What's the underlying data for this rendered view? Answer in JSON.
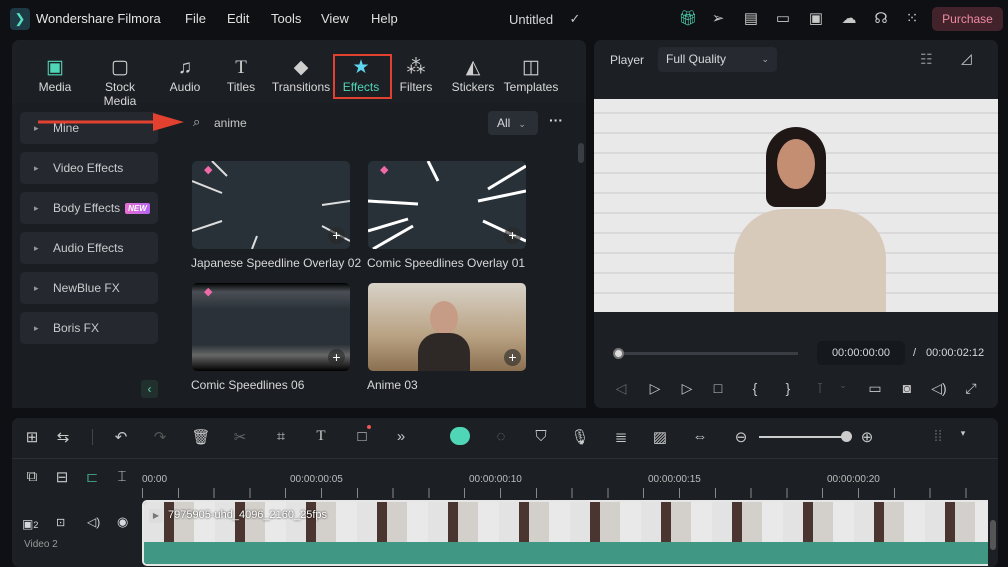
{
  "app": {
    "name": "Wondershare Filmora",
    "project_title": "Untitled",
    "purchase_label": "Purchase"
  },
  "menu": [
    "File",
    "Edit",
    "Tools",
    "View",
    "Help"
  ],
  "tabs": [
    {
      "label": "Media",
      "icon": "media-icon"
    },
    {
      "label": "Stock Media",
      "icon": "stock-media-icon"
    },
    {
      "label": "Audio",
      "icon": "music-note-icon"
    },
    {
      "label": "Titles",
      "icon": "title-t-icon"
    },
    {
      "label": "Transitions",
      "icon": "transitions-icon"
    },
    {
      "label": "Effects",
      "icon": "effects-star-icon",
      "active": true
    },
    {
      "label": "Filters",
      "icon": "filters-icon"
    },
    {
      "label": "Stickers",
      "icon": "stickers-icon"
    },
    {
      "label": "Templates",
      "icon": "templates-icon"
    }
  ],
  "sidebar": {
    "items": [
      {
        "label": "Mine"
      },
      {
        "label": "Video Effects"
      },
      {
        "label": "Body Effects",
        "badge": "NEW"
      },
      {
        "label": "Audio Effects"
      },
      {
        "label": "NewBlue FX"
      },
      {
        "label": "Boris FX"
      }
    ]
  },
  "search": {
    "value": "anime",
    "filter": "All"
  },
  "effects": [
    {
      "label": "Japanese Speedline Overlay 02",
      "premium": true
    },
    {
      "label": "Comic Speedlines Overlay 01",
      "premium": true
    },
    {
      "label": "Comic Speedlines 06",
      "premium": true
    },
    {
      "label": "Anime 03",
      "premium": false
    }
  ],
  "player": {
    "label": "Player",
    "quality": "Full Quality",
    "current_time": "00:00:00:00",
    "separator": "/",
    "total_time": "00:00:02:12",
    "progress": 0
  },
  "timeline": {
    "ruler": [
      "00:00",
      "00:00:00:05",
      "00:00:00:10",
      "00:00:00:15",
      "00:00:00:20"
    ],
    "track": {
      "name": "Video 2",
      "number": "2"
    },
    "clip_name": "7975905-uhd_4096_2160_25fps",
    "zoom_level": 0.9
  },
  "colors": {
    "accent": "#4fd6b6",
    "annotation": "#e2412f",
    "clip": "#3f9784",
    "purchase": "#f08aa3"
  }
}
